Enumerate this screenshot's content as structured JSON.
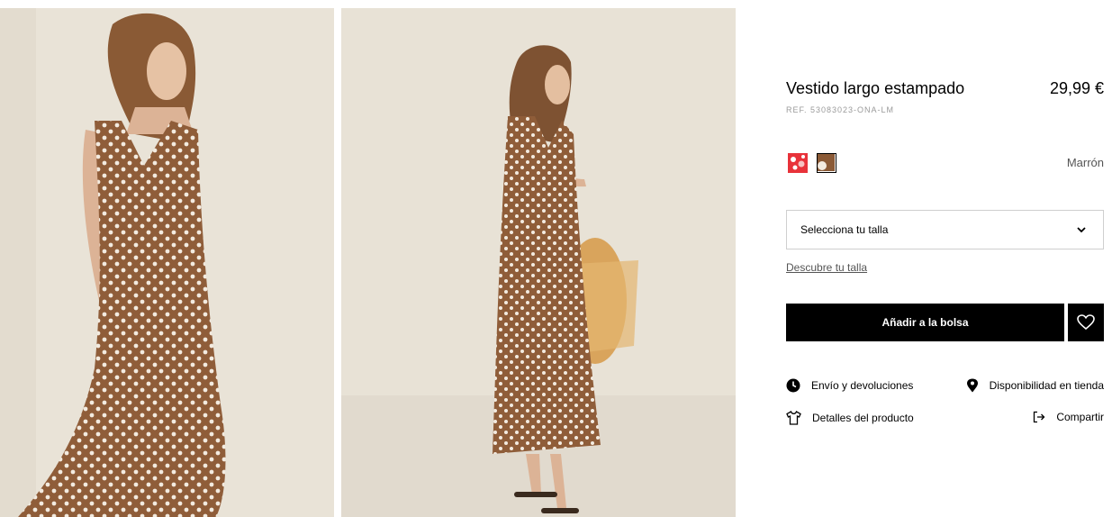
{
  "product": {
    "title": "Vestido largo estampado",
    "price": "29,99 €",
    "reference": "REF. 53083023-ONA-LM"
  },
  "colors": {
    "selected_name": "Marrón",
    "swatches": [
      {
        "icon": "red-floral-swatch",
        "color": "#e8323a",
        "selected": false
      },
      {
        "icon": "brown-polka-dot-swatch",
        "color": "#8b5a36",
        "selected": true
      }
    ]
  },
  "size": {
    "placeholder": "Selecciona tu talla",
    "guide_link": "Descubre tu talla"
  },
  "actions": {
    "add_to_bag": "Añadir a la bolsa",
    "wishlist_icon": "heart-icon"
  },
  "info_links": {
    "shipping": "Envío y devoluciones",
    "store_availability": "Disponibilidad en tienda",
    "product_details": "Detalles del producto",
    "share": "Compartir"
  },
  "images": [
    {
      "subject": "model in brown polka dot maxi dress, looking down"
    },
    {
      "subject": "model in brown polka dot maxi dress, side view with straw bag"
    }
  ]
}
